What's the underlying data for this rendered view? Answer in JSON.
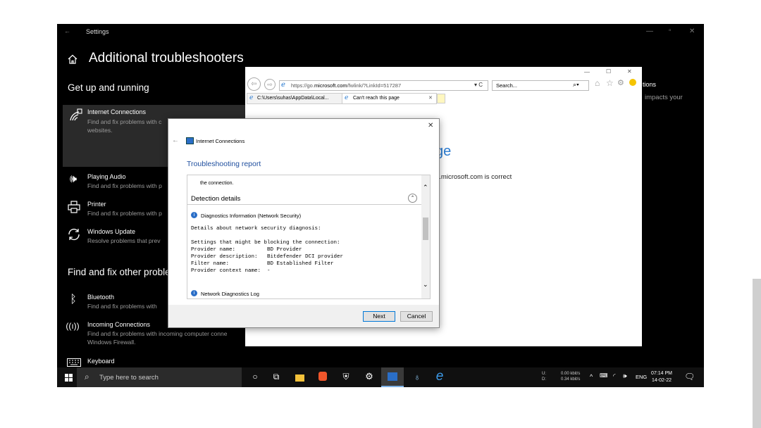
{
  "settings": {
    "titlebar": {
      "back": "←",
      "title": "Settings",
      "min": "—",
      "max": "▫",
      "close": "✕"
    },
    "page_title": "Additional troubleshooters",
    "home_icon": "home-icon",
    "section1": "Get up and running",
    "section2": "Find and fix other proble",
    "items": [
      {
        "title": "Internet Connections",
        "desc1": "Find and fix problems with c",
        "desc2": "websites."
      },
      {
        "title": "Playing Audio",
        "desc1": "Find and fix problems with p"
      },
      {
        "title": "Printer",
        "desc1": "Find and fix problems with p"
      },
      {
        "title": "Windows Update",
        "desc1": "Resolve problems that prev"
      },
      {
        "title": "Bluetooth",
        "desc1": "Find and fix problems with"
      },
      {
        "title": "Incoming Connections",
        "desc1": "Find and fix problems with incoming computer conne",
        "desc2": "Windows Firewall."
      },
      {
        "title": "Keyboard"
      }
    ],
    "right_frag1": "tions",
    "right_frag2": "impacts your"
  },
  "ie": {
    "url_prefix": "https://go.",
    "url_domain": "microsoft.com",
    "url_rest": "/fwlink/?LinkId=517287",
    "search_placeholder": "Search...",
    "tab1": "C:\\Users\\suhas\\AppData\\Local...",
    "tab2": "Can't reach this page",
    "page_frag_heading": "ge",
    "page_frag_text": "o.microsoft.com is correct",
    "min": "—",
    "max": "☐",
    "close": "✕"
  },
  "dialog": {
    "title": "Internet Connections",
    "close": "✕",
    "report_heading": "Troubleshooting report",
    "cut_text": "the connection.",
    "detection_heading": "Detection details",
    "diag_title": "Diagnostics Information (Network Security)",
    "mono_lines": [
      "Details about network security diagnosis:",
      "",
      "Settings that might be blocking the connection:",
      "Provider name:          BD Provider",
      "Provider description:   Bitdefender DCI provider",
      "Filter name:            BD Established Filter",
      "Provider context name:  -"
    ],
    "log_title": "Network Diagnostics Log",
    "next": "Next",
    "cancel": "Cancel"
  },
  "taskbar": {
    "search_placeholder": "Type here to search",
    "net_up_label": "U:",
    "net_down_label": "D:",
    "net_up": "0.00 kbit/s",
    "net_down": "0.34 kbit/s",
    "lang": "ENG",
    "time": "07:14 PM",
    "date": "14-02-22"
  }
}
